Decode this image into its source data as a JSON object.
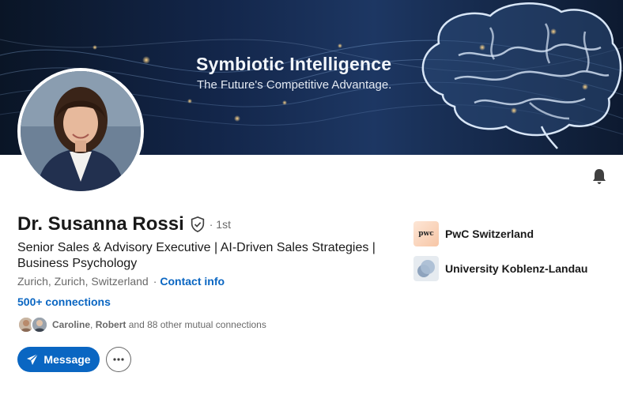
{
  "banner": {
    "title": "Symbiotic Intelligence",
    "subtitle": "The Future's Competitive Advantage.",
    "icon": "brain-illustration"
  },
  "profile": {
    "name": "Dr. Susanna Rossi",
    "degree": "· 1st",
    "headline": "Senior Sales & Advisory Executive | AI-Driven Sales Strategies | Business Psychology",
    "location": "Zurich, Zurich, Switzerland",
    "separator": "·",
    "contact_label": "Contact info",
    "connections": "500+ connections",
    "mutual": {
      "name1": "Caroline",
      "comma": ",",
      "name2": "Robert",
      "rest": "and 88 other mutual connections"
    }
  },
  "actions": {
    "message_label": "Message",
    "more_icon": "ellipsis-icon",
    "bell_icon": "bell-icon"
  },
  "organizations": [
    {
      "name": "PwC Switzerland",
      "logo_text": "pwc"
    },
    {
      "name": "University Koblenz-Landau",
      "logo_text": ""
    }
  ],
  "colors": {
    "accent": "#0a66c2",
    "banner_bg": "#13264a",
    "text_primary": "#191919",
    "text_secondary": "#666666"
  }
}
